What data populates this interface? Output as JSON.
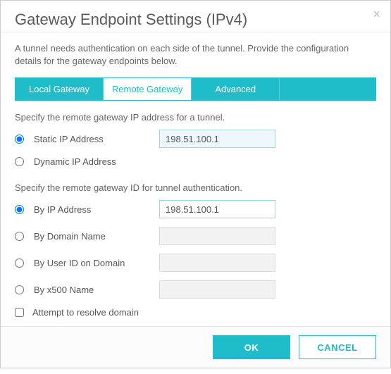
{
  "header": {
    "title": "Gateway Endpoint Settings (IPv4)",
    "close_label": "×"
  },
  "description": "A tunnel needs authentication on each side of the tunnel. Provide the configuration details for the gateway endpoints below.",
  "tabs": {
    "local": "Local Gateway",
    "remote": "Remote Gateway",
    "advanced": "Advanced",
    "active": "remote"
  },
  "ip_section": {
    "prompt": "Specify the remote gateway IP address for a tunnel.",
    "static_label": "Static IP Address",
    "static_value": "198.51.100.1",
    "dynamic_label": "Dynamic IP Address",
    "selected": "static"
  },
  "id_section": {
    "prompt": "Specify the remote gateway ID for tunnel authentication.",
    "by_ip_label": "By IP Address",
    "by_ip_value": "198.51.100.1",
    "by_domain_label": "By Domain Name",
    "by_domain_value": "",
    "by_userid_label": "By User ID on Domain",
    "by_userid_value": "",
    "by_x500_label": "By x500 Name",
    "by_x500_value": "",
    "selected": "by_ip"
  },
  "resolve_domain": {
    "label": "Attempt to resolve domain",
    "checked": false
  },
  "footer": {
    "ok": "OK",
    "cancel": "CANCEL"
  }
}
